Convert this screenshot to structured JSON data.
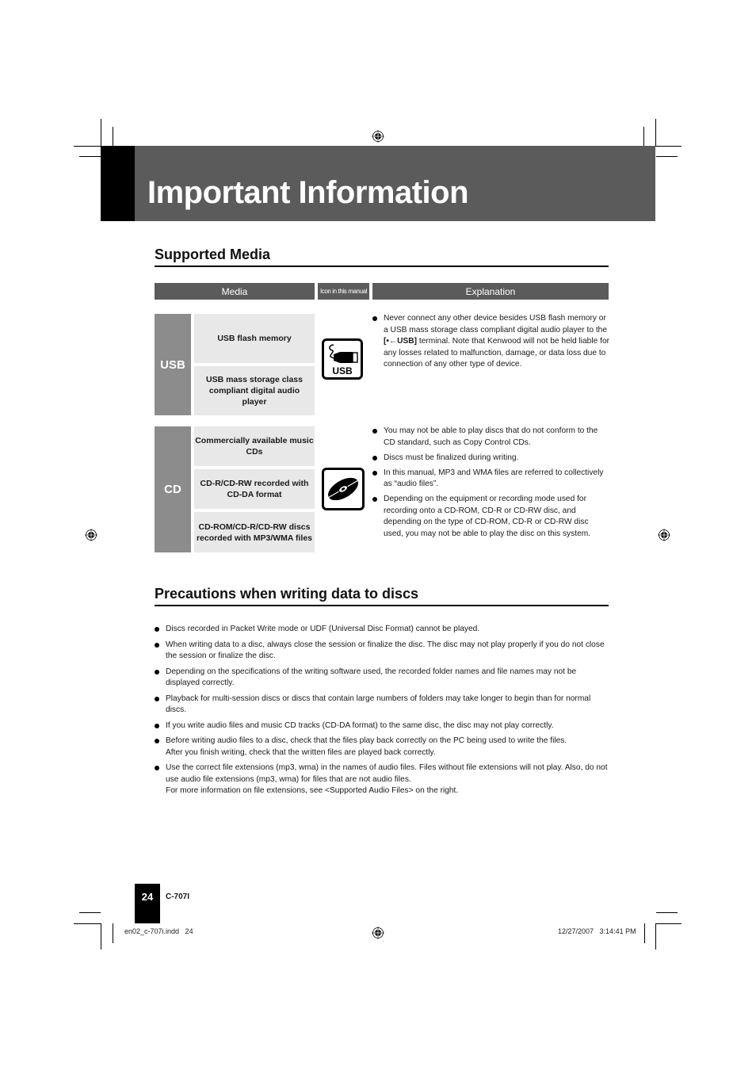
{
  "header": {
    "title": "Important Information"
  },
  "supported_media": {
    "title": "Supported Media",
    "columns": {
      "media": "Media",
      "icon": "Icon in this manual",
      "explanation": "Explanation"
    },
    "groups": [
      {
        "category": "USB",
        "icon": "usb-icon",
        "icon_label": "USB",
        "media": [
          "USB flash memory",
          "USB mass storage class compliant digital audio player"
        ],
        "explanation": [
          {
            "pre": "Never connect any other device besides USB flash memory or a USB mass storage class compliant digital audio player to the ",
            "bold": "[•←USB]",
            "post": " terminal. Note that Kenwood will not be held liable for any losses related to malfunction, damage, or data loss due to connection of any other type of device."
          }
        ]
      },
      {
        "category": "CD",
        "icon": "cd-icon",
        "media": [
          "Commercially available music CDs",
          "CD-R/CD-RW recorded with CD-DA format",
          "CD-ROM/CD-R/CD-RW discs recorded with MP3/WMA files"
        ],
        "explanation": [
          "You may not be able to play discs that do not conform to the CD standard, such as Copy Control CDs.",
          "Discs must be finalized during writing.",
          "In this manual, MP3 and WMA files are referred to collectively as “audio files”.",
          "Depending on the equipment or recording mode used for recording onto a CD-ROM, CD-R or CD-RW disc, and depending on the type of CD-ROM, CD-R or CD-RW disc used, you may not be able to play the disc on this system."
        ]
      }
    ]
  },
  "precautions": {
    "title": "Precautions when writing data to discs",
    "items": [
      "Discs recorded in Packet Write mode or UDF (Universal Disc Format) cannot be played.",
      "When writing data to a disc, always close the session or finalize the disc. The disc may not play properly if you do not close the session or finalize the disc.",
      "Depending on the specifications of the writing software used, the recorded folder names and file names may not be displayed correctly.",
      "Playback for multi-session discs or discs that contain large numbers of folders may take longer to begin than for normal discs.",
      "If you write audio files and music CD tracks (CD-DA format) to the same disc, the disc may not play correctly.",
      [
        "Before writing audio files to a disc, check that the files play back correctly on the PC being used to write the files.",
        "After you finish writing, check that the written files are played back correctly."
      ],
      [
        "Use the correct file extensions (mp3, wma) in the names of audio files. Files without file extensions will not play. Also, do not use audio file extensions (mp3, wma) for files that are not audio files.",
        "For more information on file extensions, see <Supported Audio Files> on the right."
      ]
    ]
  },
  "footer": {
    "page_number": "24",
    "model": "C-707I",
    "slug_file": "en02_c-707i.indd   24",
    "slug_date": "12/27/2007   3:14:41 PM"
  }
}
